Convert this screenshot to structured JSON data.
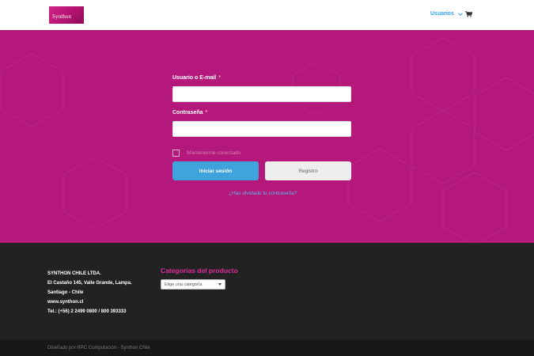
{
  "header": {
    "logo_text": "Synthon",
    "nav_users_label": "Usuarios",
    "cart_icon": "cart-icon"
  },
  "login_form": {
    "username_label": "Usuario o E-mail",
    "password_label": "Contraseña",
    "required_mark": "*",
    "username_value": "",
    "password_value": "",
    "remember_label": "Mantenerme conectado",
    "remember_checked": false,
    "login_button": "Iniciar sesión",
    "register_button": "Registro",
    "forgot_link": "¿Has olvidado tu contraseña?"
  },
  "footer": {
    "company_lines": [
      "SYNTHON CHILE LTDA.",
      "El Castaño 145, Valle Grande, Lampa.",
      "Santiago - Chile",
      "www.synthon.cl",
      "Tel.: (+56) 2 2499 0800 / 800 393333"
    ],
    "categories_title": "Categorías del producto",
    "categories_select_value": "Elige una categoría",
    "credits": "Diseñado por RPC Computación - Synthon Chile"
  },
  "colors": {
    "hero_magenta": "#b3187a",
    "primary_blue": "#3fa3dc",
    "footer_dark": "#222222",
    "accent_pink": "#e02b9a"
  }
}
